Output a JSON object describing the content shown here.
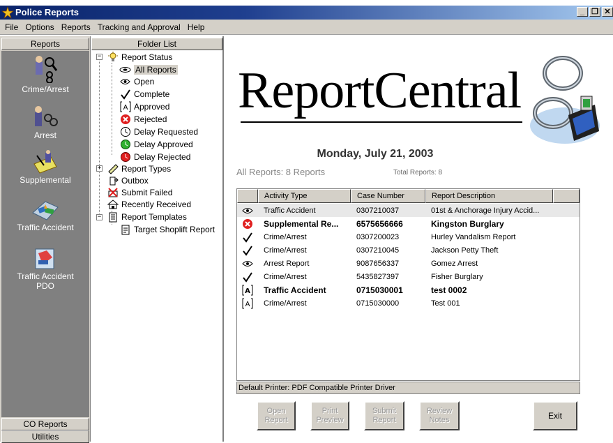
{
  "window": {
    "title": "Police Reports"
  },
  "menu": [
    "File",
    "Options",
    "Reports",
    "Tracking and Approval",
    "Help"
  ],
  "outlook_bar": {
    "header": "Reports",
    "items": [
      "Crime/Arrest",
      "Arrest",
      "Supplemental",
      "Traffic Accident",
      "Traffic Accident PDO"
    ],
    "footer_items": [
      "CO Reports",
      "Utilities"
    ]
  },
  "folder_list": {
    "header": "Folder List",
    "report_status": "Report Status",
    "status_items": [
      "All Reports",
      "Open",
      "Complete",
      "Approved",
      "Rejected",
      "Delay Requested",
      "Delay Approved",
      "Delay Rejected"
    ],
    "report_types": "Report Types",
    "outbox": "Outbox",
    "submit_failed": "Submit Failed",
    "recently_received": "Recently Received",
    "report_templates": "Report Templates",
    "template_item": "Target Shoplift Report"
  },
  "main": {
    "logo": "ReportCentral",
    "date": "Monday, July 21, 2003",
    "all_reports": "All Reports: 8 Reports",
    "total_reports": "Total Reports: 8",
    "columns": [
      "Activity Type",
      "Case Number",
      "Report Description"
    ],
    "rows": [
      {
        "icon": "open",
        "activity": "Traffic Accident",
        "case": "0307210037",
        "desc": "01st & Anchorage Injury Accid...",
        "bold": false,
        "selected": true
      },
      {
        "icon": "rejected",
        "activity": "Supplemental Re...",
        "case": "6575656666",
        "desc": "Kingston Burglary",
        "bold": true,
        "selected": false
      },
      {
        "icon": "complete",
        "activity": "Crime/Arrest",
        "case": "0307200023",
        "desc": "Hurley Vandalism Report",
        "bold": false,
        "selected": false
      },
      {
        "icon": "complete",
        "activity": "Crime/Arrest",
        "case": "0307210045",
        "desc": "Jackson Petty Theft",
        "bold": false,
        "selected": false
      },
      {
        "icon": "open",
        "activity": "Arrest Report",
        "case": "9087656337",
        "desc": "Gomez Arrest",
        "bold": false,
        "selected": false
      },
      {
        "icon": "complete",
        "activity": "Crime/Arrest",
        "case": "5435827397",
        "desc": "Fisher Burglary",
        "bold": false,
        "selected": false
      },
      {
        "icon": "approved",
        "activity": "Traffic Accident",
        "case": "0715030001",
        "desc": "test 0002",
        "bold": true,
        "selected": false
      },
      {
        "icon": "approved",
        "activity": "Crime/Arrest",
        "case": "0715030000",
        "desc": "Test 001",
        "bold": false,
        "selected": false
      }
    ],
    "status_bar": "Default Printer:  PDF Compatible Printer Driver",
    "buttons": [
      {
        "line1": "Open",
        "line2": "Report",
        "enabled": false
      },
      {
        "line1": "Print",
        "line2": "Preview",
        "enabled": false
      },
      {
        "line1": "Submit",
        "line2": "Report",
        "enabled": false
      },
      {
        "line1": "Review",
        "line2": "Notes",
        "enabled": false
      },
      {
        "line1": "Exit",
        "line2": "",
        "enabled": true
      }
    ]
  }
}
